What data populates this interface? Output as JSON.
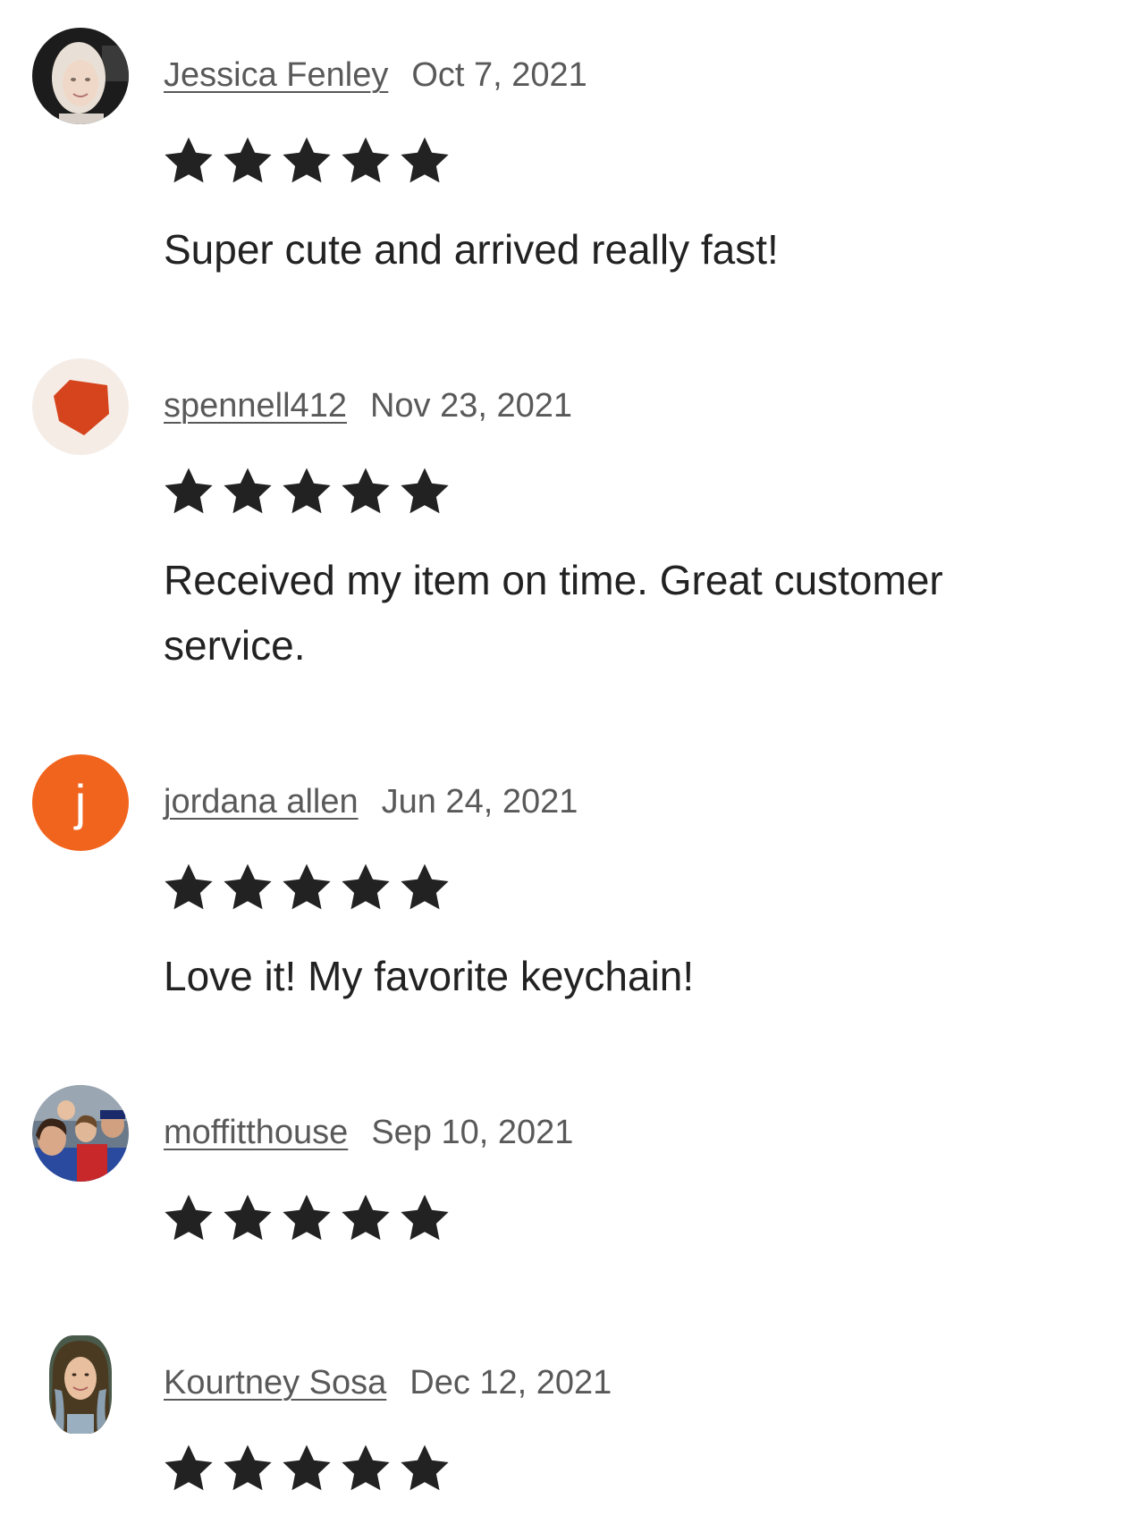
{
  "reviews": [
    {
      "reviewer": "Jessica Fenley",
      "date": "Oct 7, 2021",
      "rating": 5,
      "text": "Super cute and arrived really fast!",
      "avatar": {
        "type": "photo",
        "icon": "woman-portrait-photo"
      }
    },
    {
      "reviewer": "spennell412",
      "date": "Nov 23, 2021",
      "rating": 5,
      "text": "Received my item on time. Great customer service.",
      "avatar": {
        "type": "default",
        "icon": "red-pentagon-icon",
        "bg": "#f5ece6",
        "color": "#d5441c"
      }
    },
    {
      "reviewer": "jordana allen",
      "date": "Jun 24, 2021",
      "rating": 5,
      "text": "Love it! My favorite keychain!",
      "avatar": {
        "type": "initial",
        "initial": "j",
        "bg": "#f1641e"
      }
    },
    {
      "reviewer": "moffitthouse",
      "date": "Sep 10, 2021",
      "rating": 5,
      "text": "",
      "avatar": {
        "type": "photo",
        "icon": "family-group-photo"
      }
    },
    {
      "reviewer": "Kourtney Sosa",
      "date": "Dec 12, 2021",
      "rating": 5,
      "text": "",
      "avatar": {
        "type": "photo",
        "icon": "woman-selfie-photo"
      }
    }
  ],
  "colors": {
    "star": "#222222",
    "meta_text": "#595959",
    "body_text": "#222222"
  }
}
